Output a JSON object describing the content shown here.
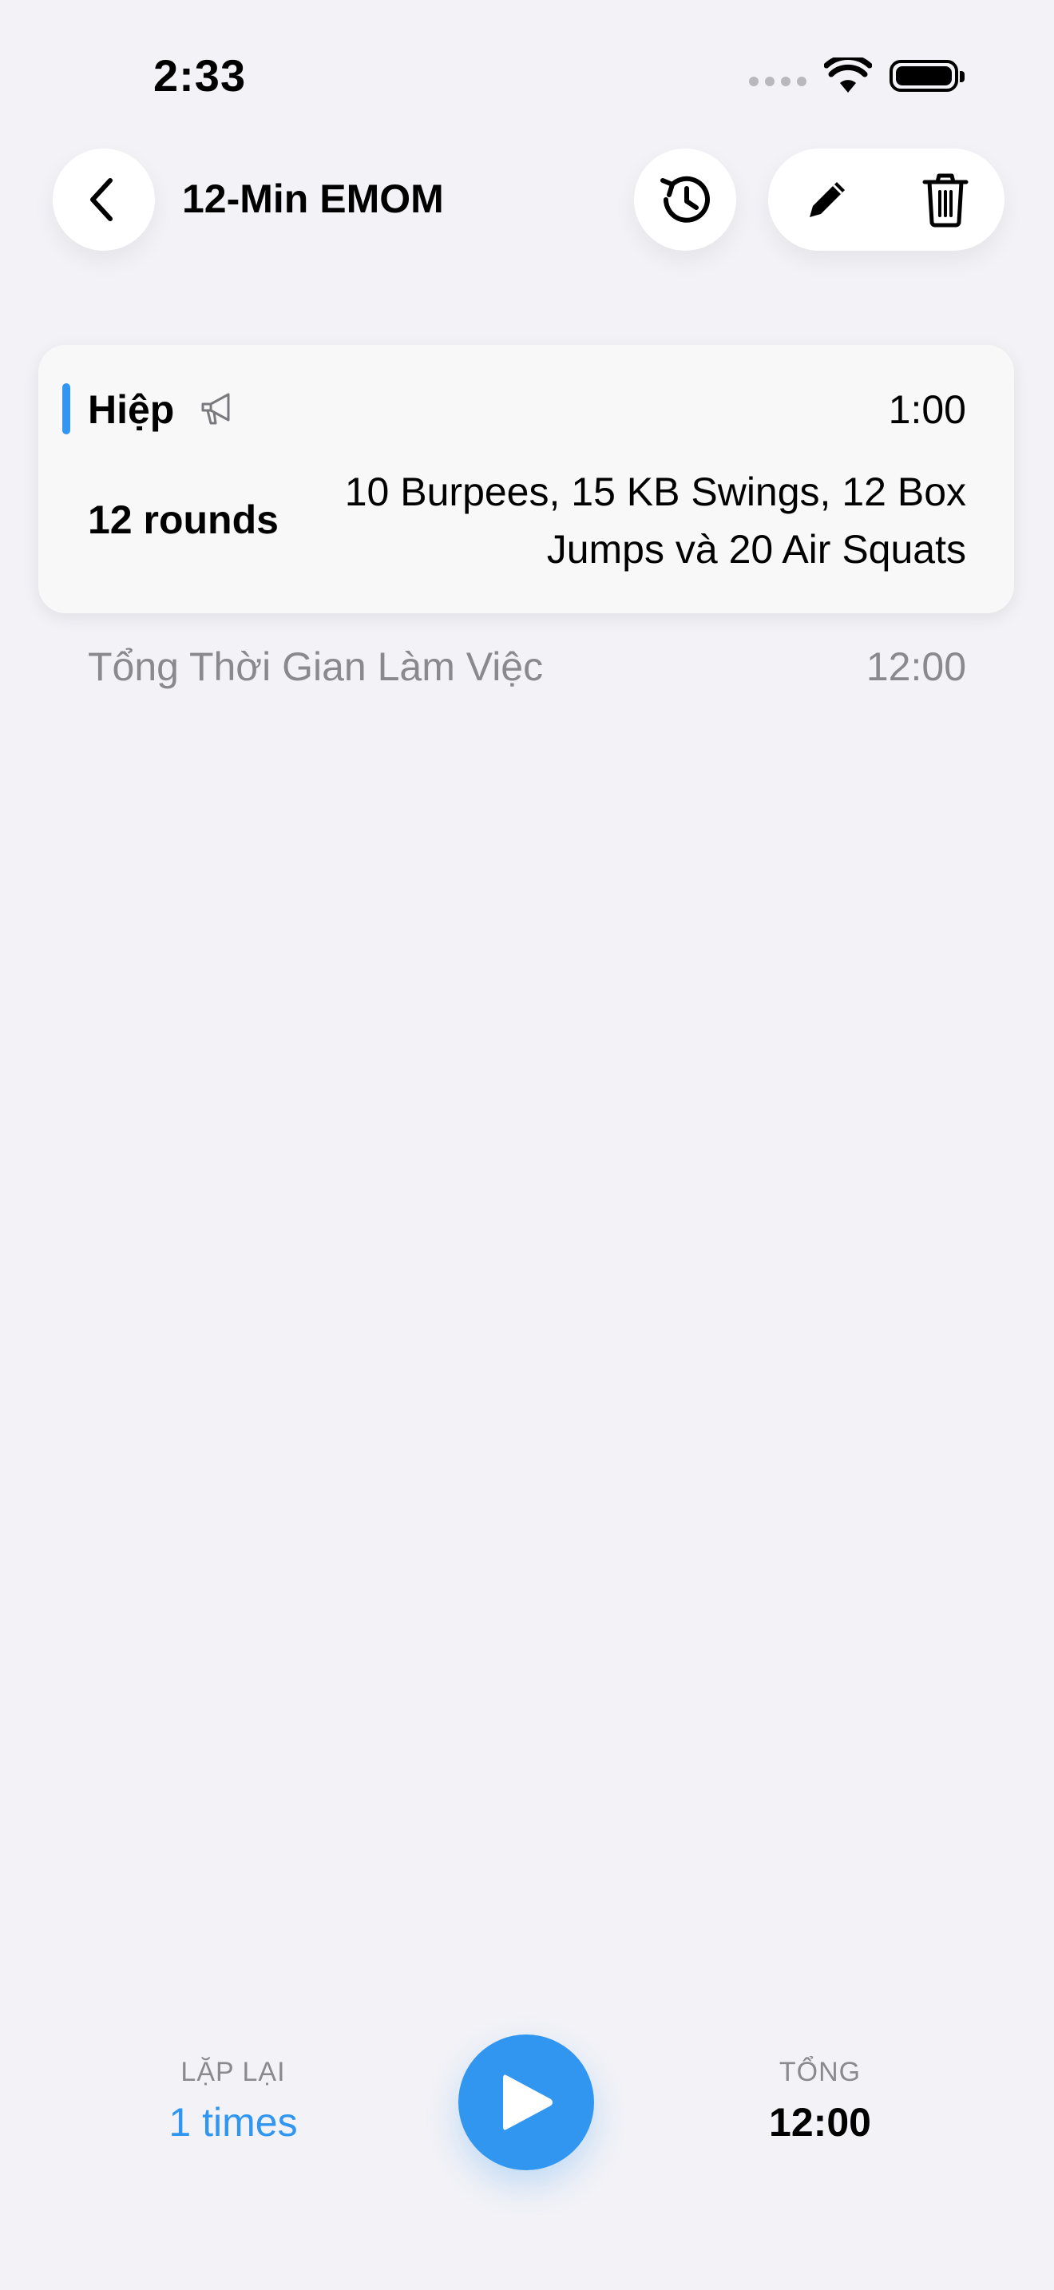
{
  "status_bar": {
    "time": "2:33"
  },
  "nav": {
    "title": "12-Min EMOM",
    "icons": {
      "back": "chevron-left-icon",
      "history": "history-icon",
      "edit": "pencil-icon",
      "delete": "trash-icon"
    }
  },
  "card": {
    "title": "Hiệp",
    "icon": "megaphone-icon",
    "duration": "1:00",
    "rounds": "12 rounds",
    "description": "10 Burpees, 15 KB Swings, 12 Box Jumps và 20 Air Squats",
    "accent_color": "#3096f0"
  },
  "summary": {
    "label": "Tổng Thời Gian Làm Việc",
    "value": "12:00"
  },
  "bottom_bar": {
    "repeat_label": "LẶP LẠI",
    "repeat_value": "1 times",
    "total_label": "TỔNG",
    "total_value": "12:00",
    "play_icon": "play-icon",
    "accent_color": "#3096f0"
  }
}
